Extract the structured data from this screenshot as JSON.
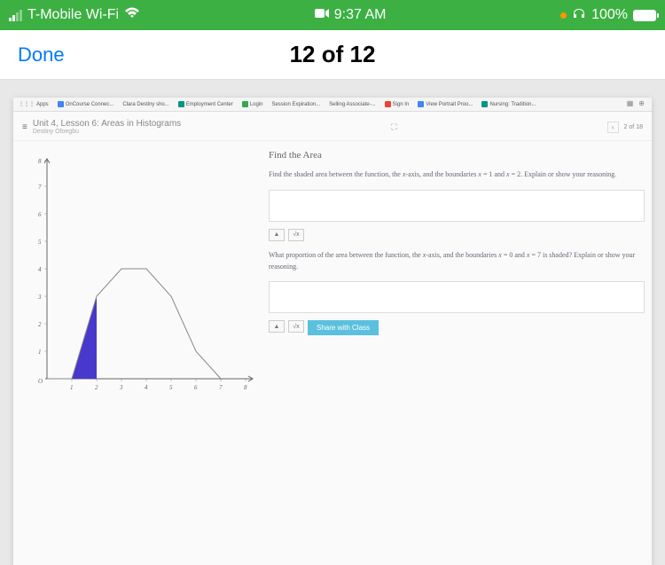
{
  "status_bar": {
    "carrier": "T-Mobile Wi-Fi",
    "time": "9:37 AM",
    "battery": "100%"
  },
  "nav": {
    "done": "Done",
    "page_indicator": "12 of 12"
  },
  "bookmarks": [
    {
      "label": "Apps"
    },
    {
      "label": "OnCourse Connec..."
    },
    {
      "label": "Clara Destiny sho..."
    },
    {
      "label": "Employment Center"
    },
    {
      "label": "Login"
    },
    {
      "label": "Session Expiration..."
    },
    {
      "label": "Selling Associate-..."
    },
    {
      "label": "Sign In"
    },
    {
      "label": "View Portrait Proo..."
    },
    {
      "label": "Nursing: Tradition..."
    }
  ],
  "lesson": {
    "title": "Unit 4, Lesson 6: Areas in Histograms",
    "student": "Destiny Ofoegbu",
    "progress": "2 of 18"
  },
  "content": {
    "heading": "Find the Area",
    "q1": "Find the shaded area between the function, the x-axis, and the boundaries x = 1 and x = 2. Explain or show your reasoning.",
    "q2": "What proportion of the area between the function, the x-axis, and the boundaries x = 0 and x = 7 is shaded? Explain or show your reasoning.",
    "share_button": "Share with Class"
  },
  "chart_data": {
    "type": "area",
    "title": "",
    "xlabel": "",
    "ylabel": "",
    "xlim": [
      0,
      8
    ],
    "ylim": [
      0,
      8
    ],
    "x_ticks": [
      1,
      2,
      3,
      4,
      5,
      6,
      7,
      8
    ],
    "y_ticks": [
      1,
      2,
      3,
      4,
      5,
      6,
      7,
      8
    ],
    "curve_points": [
      {
        "x": 0,
        "y": 0
      },
      {
        "x": 1,
        "y": 0
      },
      {
        "x": 2,
        "y": 3
      },
      {
        "x": 3,
        "y": 4
      },
      {
        "x": 4,
        "y": 4
      },
      {
        "x": 5,
        "y": 3
      },
      {
        "x": 6,
        "y": 1
      },
      {
        "x": 7,
        "y": 0
      }
    ],
    "shaded_region": {
      "x_start": 1,
      "x_end": 2,
      "points": [
        {
          "x": 1,
          "y": 0
        },
        {
          "x": 2,
          "y": 3
        },
        {
          "x": 2,
          "y": 0
        }
      ]
    }
  }
}
